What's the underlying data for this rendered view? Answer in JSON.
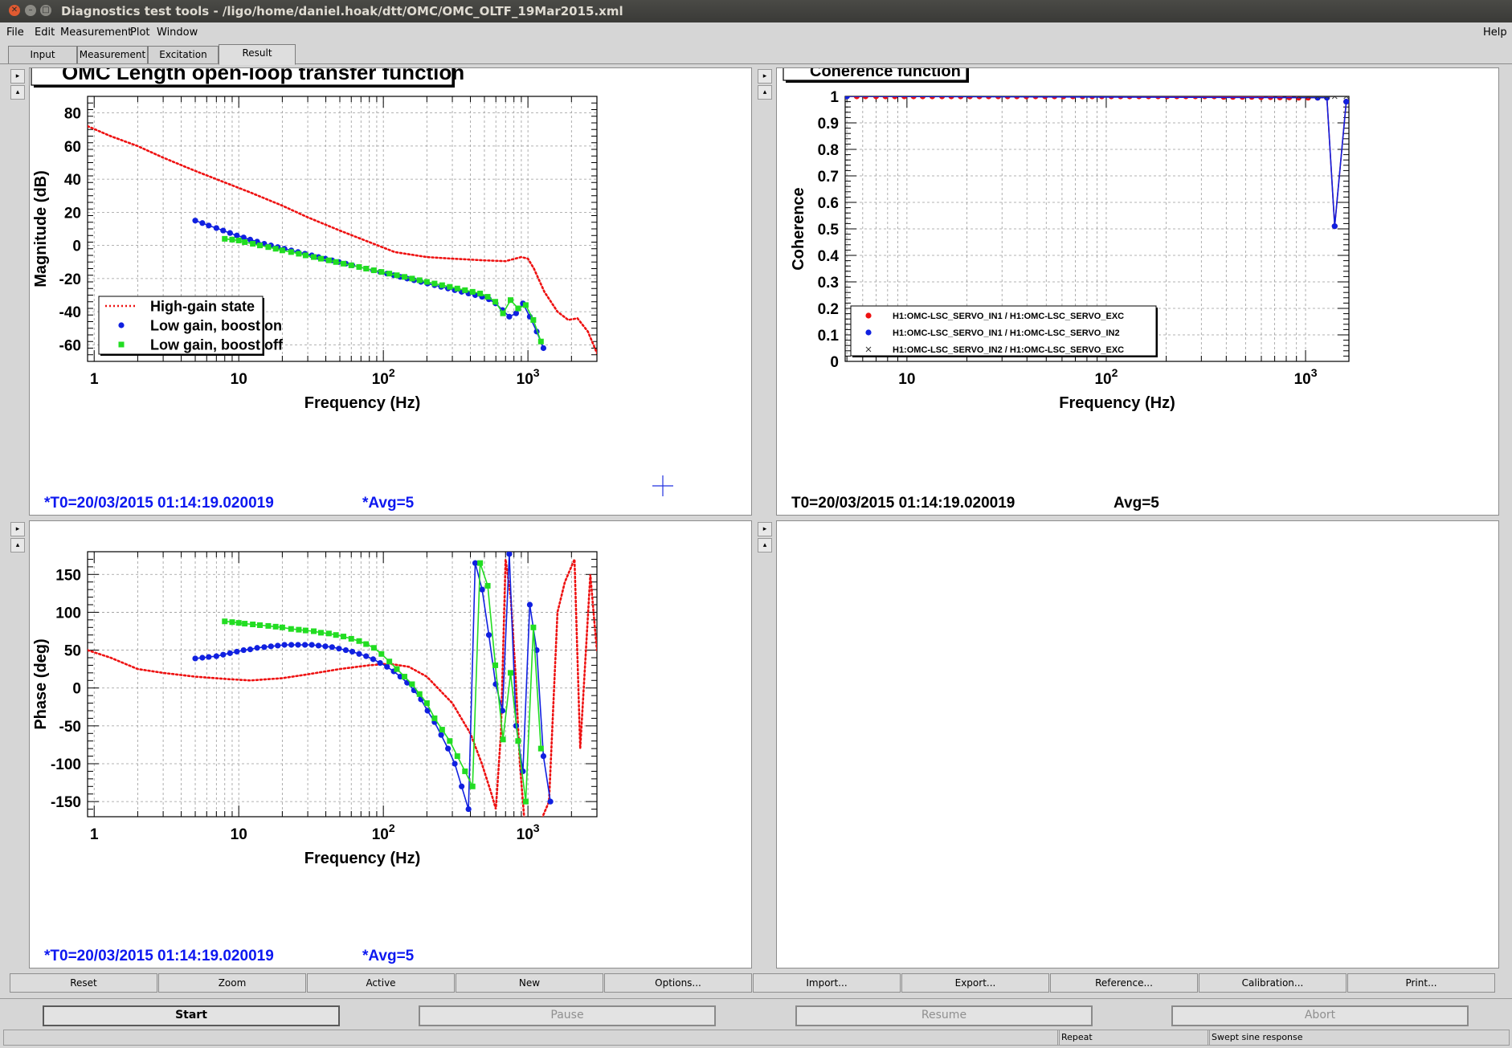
{
  "window": {
    "title": "Diagnostics test tools - /ligo/home/daniel.hoak/dtt/OMC/OMC_OLTF_19Mar2015.xml",
    "close_glyph": "✕",
    "minimize_glyph": "–",
    "maximize_glyph": "□"
  },
  "menu": {
    "items": [
      "File",
      "Edit",
      "Measurement",
      "Plot",
      "Window"
    ],
    "help": "Help"
  },
  "tabs": [
    "Input",
    "Measurement",
    "Excitation",
    "Result"
  ],
  "tab_active": "Result",
  "pads": {
    "magnitude": {
      "t0": "*T0=20/03/2015 01:14:19.020019",
      "avg": "*Avg=5"
    },
    "coherence": {
      "t0": "T0=20/03/2015 01:14:19.020019",
      "avg": "Avg=5"
    },
    "phase": {
      "t0": "*T0=20/03/2015 01:14:19.020019",
      "avg": "*Avg=5"
    }
  },
  "scroll_glyphs": {
    "right": "▸",
    "up": "▴"
  },
  "chart_data": [
    {
      "type": "line",
      "title": "OMC Length open-loop transfer function",
      "xlabel": "Frequency (Hz)",
      "ylabel": "Magnitude (dB)",
      "xscale": "log",
      "xlim": [
        0.9,
        3000
      ],
      "ylim": [
        -70,
        90
      ],
      "yticks": [
        80,
        60,
        40,
        20,
        0,
        -20,
        -40,
        -60
      ],
      "xticks": [
        1,
        10,
        100,
        1000
      ],
      "xtick_labels": [
        {
          "base": "1",
          "exp": ""
        },
        {
          "base": "10",
          "exp": ""
        },
        {
          "base": "10",
          "exp": "2"
        },
        {
          "base": "10",
          "exp": "3"
        }
      ],
      "grid": true,
      "legend_position": "bottom-left",
      "series": [
        {
          "name": "High-gain state",
          "color": "#ee1111",
          "style": "dotted",
          "x": [
            0.9,
            1.3,
            2,
            3,
            5,
            8,
            12,
            20,
            30,
            50,
            80,
            120,
            200,
            300,
            500,
            700,
            900,
            1000,
            1100,
            1300,
            1600,
            1900,
            2200,
            2600,
            3000
          ],
          "y": [
            72,
            66,
            60,
            53,
            45,
            38,
            32,
            24,
            17,
            9,
            2,
            -4,
            -7,
            -8,
            -9,
            -9.5,
            -7,
            -8,
            -14,
            -28,
            -40,
            -45,
            -44,
            -52,
            -65
          ]
        },
        {
          "name": "Low gain, boost on",
          "color": "#1020e0",
          "marker": "circle",
          "x": [
            5,
            5.6,
            6.2,
            7,
            7.8,
            8.7,
            9.7,
            10.8,
            12,
            13.4,
            15,
            16.7,
            18.6,
            20.7,
            23.1,
            25.7,
            28.7,
            32,
            35.6,
            39.7,
            44.2,
            49.3,
            55,
            61,
            68,
            76,
            85,
            95,
            106,
            118,
            131,
            146,
            163,
            182,
            202,
            226,
            251,
            280,
            312,
            348,
            388,
            432,
            482,
            537,
            598,
            667,
            743,
            828,
            923,
            1030,
            1150,
            1280
          ],
          "y": [
            15,
            13.5,
            12,
            10.5,
            9,
            7.5,
            6,
            4.8,
            3.5,
            2.3,
            1,
            0,
            -1,
            -2,
            -3,
            -4,
            -5,
            -6,
            -7,
            -8,
            -9,
            -10,
            -11,
            -12,
            -13,
            -14,
            -15,
            -16,
            -17,
            -18,
            -19,
            -20,
            -21,
            -22,
            -23,
            -24,
            -25,
            -26,
            -27,
            -28,
            -29,
            -30,
            -31,
            -32.5,
            -35,
            -39,
            -43,
            -41,
            -35,
            -43,
            -52,
            -62
          ]
        },
        {
          "name": "Low gain, boost off",
          "color": "#22dd22",
          "marker": "square",
          "x": [
            8,
            9,
            10,
            11,
            12.5,
            14,
            16,
            18,
            20,
            23,
            26,
            29,
            33,
            37,
            42,
            47,
            53,
            60,
            68,
            76,
            86,
            97,
            110,
            124,
            140,
            158,
            178,
            200,
            226,
            255,
            288,
            325,
            367,
            414,
            467,
            527,
            595,
            672,
            758,
            855,
            966,
            1090,
            1230
          ],
          "y": [
            4,
            3.5,
            3,
            2,
            1,
            0,
            -1,
            -2,
            -3,
            -4,
            -5,
            -6,
            -7,
            -8,
            -9,
            -10,
            -11,
            -12,
            -13,
            -14,
            -15,
            -16,
            -17,
            -18,
            -19,
            -20,
            -21,
            -22,
            -23,
            -24,
            -25,
            -26,
            -27,
            -28,
            -29,
            -31,
            -34,
            -41,
            -33,
            -38,
            -36,
            -45,
            -58
          ]
        }
      ]
    },
    {
      "type": "line",
      "title": "Coherence function",
      "xlabel": "Frequency (Hz)",
      "ylabel": "Coherence",
      "xscale": "log",
      "xlim": [
        4.9,
        1650
      ],
      "ylim": [
        0,
        1
      ],
      "yticks": [
        0,
        0.1,
        0.2,
        0.3,
        0.4,
        0.5,
        0.6,
        0.7,
        0.8,
        0.9,
        1
      ],
      "xticks": [
        10,
        100,
        1000
      ],
      "xtick_labels": [
        {
          "base": "10",
          "exp": ""
        },
        {
          "base": "10",
          "exp": "2"
        },
        {
          "base": "10",
          "exp": "3"
        }
      ],
      "grid": true,
      "legend_position": "bottom-left",
      "series": [
        {
          "name": "H1:OMC-LSC_SERVO_IN1 / H1:OMC-LSC_SERVO_EXC",
          "color": "#ee1111",
          "marker": "circle",
          "x": [
            5,
            5.6,
            6.2,
            7,
            7.8,
            8.7,
            9.7,
            10.8,
            12,
            13.4,
            15,
            16.7,
            18.6,
            20.7,
            23.1,
            25.7,
            28.7,
            32,
            35.6,
            39.7,
            44.2,
            49.3,
            55,
            61,
            68,
            76,
            85,
            95,
            106,
            118,
            131,
            146,
            163,
            182,
            202,
            226,
            251,
            280,
            312,
            348,
            388,
            432,
            482,
            537,
            598,
            667,
            743,
            828,
            923,
            1030,
            1150,
            1280,
            1400,
            1600
          ],
          "y": [
            1,
            1,
            1,
            1,
            1,
            1,
            1,
            1,
            1,
            1,
            1,
            1,
            1,
            1,
            1,
            1,
            1,
            1,
            1,
            1,
            1,
            1,
            1,
            1,
            1,
            1,
            1,
            1,
            1,
            1,
            1,
            1,
            1,
            1,
            1,
            1,
            1,
            1,
            1,
            1,
            0.998,
            0.998,
            0.998,
            0.998,
            0.997,
            0.997,
            0.996,
            0.996,
            0.995,
            0.995,
            0.995,
            0.995,
            0.51,
            0.98
          ]
        },
        {
          "name": "H1:OMC-LSC_SERVO_IN1 / H1:OMC-LSC_SERVO_IN2",
          "color": "#1020e0",
          "marker": "circle",
          "x": [
            5,
            1150,
            1280,
            1400,
            1600
          ],
          "y": [
            1,
            0.995,
            0.995,
            0.51,
            0.98
          ]
        },
        {
          "name": "H1:OMC-LSC_SERVO_IN2 / H1:OMC-LSC_SERVO_EXC",
          "color": "#333333",
          "marker": "cross",
          "x": [
            923,
            1030,
            1150,
            1280,
            1400,
            1600
          ],
          "y": [
            1,
            1,
            1,
            1,
            1,
            1
          ]
        }
      ]
    },
    {
      "type": "line",
      "title": "",
      "xlabel": "Frequency (Hz)",
      "ylabel": "Phase (deg)",
      "xscale": "log",
      "xlim": [
        0.9,
        3000
      ],
      "ylim": [
        -170,
        180
      ],
      "yticks": [
        150,
        100,
        50,
        0,
        -50,
        -100,
        -150
      ],
      "xticks": [
        1,
        10,
        100,
        1000
      ],
      "xtick_labels": [
        {
          "base": "1",
          "exp": ""
        },
        {
          "base": "10",
          "exp": ""
        },
        {
          "base": "10",
          "exp": "2"
        },
        {
          "base": "10",
          "exp": "3"
        }
      ],
      "grid": true,
      "series": [
        {
          "name": "High-gain state",
          "color": "#ee1111",
          "style": "dotted",
          "x": [
            0.9,
            1.3,
            2,
            3,
            5,
            8,
            12,
            20,
            30,
            50,
            80,
            110,
            150,
            200,
            300,
            400,
            480,
            560,
            600,
            650,
            700,
            760,
            820,
            880,
            950,
            1050,
            1200,
            1400,
            1600,
            1800,
            2100,
            2300,
            2700,
            2900,
            3000
          ],
          "y": [
            50,
            40,
            25,
            20,
            15,
            12,
            10,
            13,
            18,
            25,
            30,
            32,
            28,
            15,
            -20,
            -60,
            -100,
            -140,
            -160,
            -60,
            170,
            120,
            20,
            -100,
            -180,
            -180,
            -180,
            -150,
            100,
            140,
            170,
            -80,
            150,
            80,
            50
          ]
        },
        {
          "name": "Low gain, boost on",
          "color": "#1020e0",
          "marker": "circle",
          "x": [
            5,
            5.6,
            6.2,
            7,
            7.8,
            8.7,
            9.7,
            10.8,
            12,
            13.4,
            15,
            16.7,
            18.6,
            20.7,
            23.1,
            25.7,
            28.7,
            32,
            35.6,
            39.7,
            44.2,
            49.3,
            55,
            61,
            68,
            76,
            85,
            95,
            106,
            118,
            131,
            146,
            163,
            182,
            202,
            226,
            251,
            280,
            312,
            348,
            388,
            432,
            482,
            537,
            598,
            667,
            743,
            828,
            923,
            1030,
            1150,
            1280,
            1430
          ],
          "y": [
            39,
            40,
            41,
            42,
            44,
            46,
            48,
            50,
            51,
            53,
            54,
            55,
            56,
            57,
            57,
            57,
            57,
            57,
            56,
            55,
            54,
            52,
            50,
            48,
            45,
            42,
            38,
            33,
            28,
            22,
            15,
            7,
            -3,
            -15,
            -30,
            -45,
            -62,
            -80,
            -100,
            -130,
            -160,
            165,
            130,
            70,
            5,
            -30,
            177,
            -50,
            -110,
            110,
            50,
            -90,
            -150
          ]
        },
        {
          "name": "Low gain, boost off",
          "color": "#22dd22",
          "marker": "square",
          "x": [
            8,
            9,
            10,
            11,
            12.5,
            14,
            16,
            18,
            20,
            23,
            26,
            29,
            33,
            37,
            42,
            47,
            53,
            60,
            68,
            76,
            86,
            97,
            110,
            124,
            140,
            158,
            178,
            200,
            226,
            255,
            288,
            325,
            367,
            414,
            467,
            527,
            595,
            672,
            758,
            855,
            966,
            1090,
            1230
          ],
          "y": [
            88,
            87,
            86,
            85,
            84,
            83,
            82,
            81,
            80,
            78,
            77,
            76,
            75,
            73,
            72,
            70,
            68,
            65,
            62,
            58,
            53,
            45,
            35,
            25,
            15,
            5,
            -8,
            -20,
            -40,
            -55,
            -70,
            -90,
            -110,
            -130,
            165,
            135,
            30,
            -68,
            20,
            -70,
            -150,
            80,
            -80
          ]
        }
      ]
    }
  ],
  "toolbar": [
    "Reset",
    "Zoom",
    "Active",
    "New",
    "Options...",
    "Import...",
    "Export...",
    "Reference...",
    "Calibration...",
    "Print..."
  ],
  "controls": [
    "Start",
    "Pause",
    "Resume",
    "Abort"
  ],
  "status": {
    "left": "",
    "middle": "Repeat",
    "right": "Swept sine response"
  }
}
